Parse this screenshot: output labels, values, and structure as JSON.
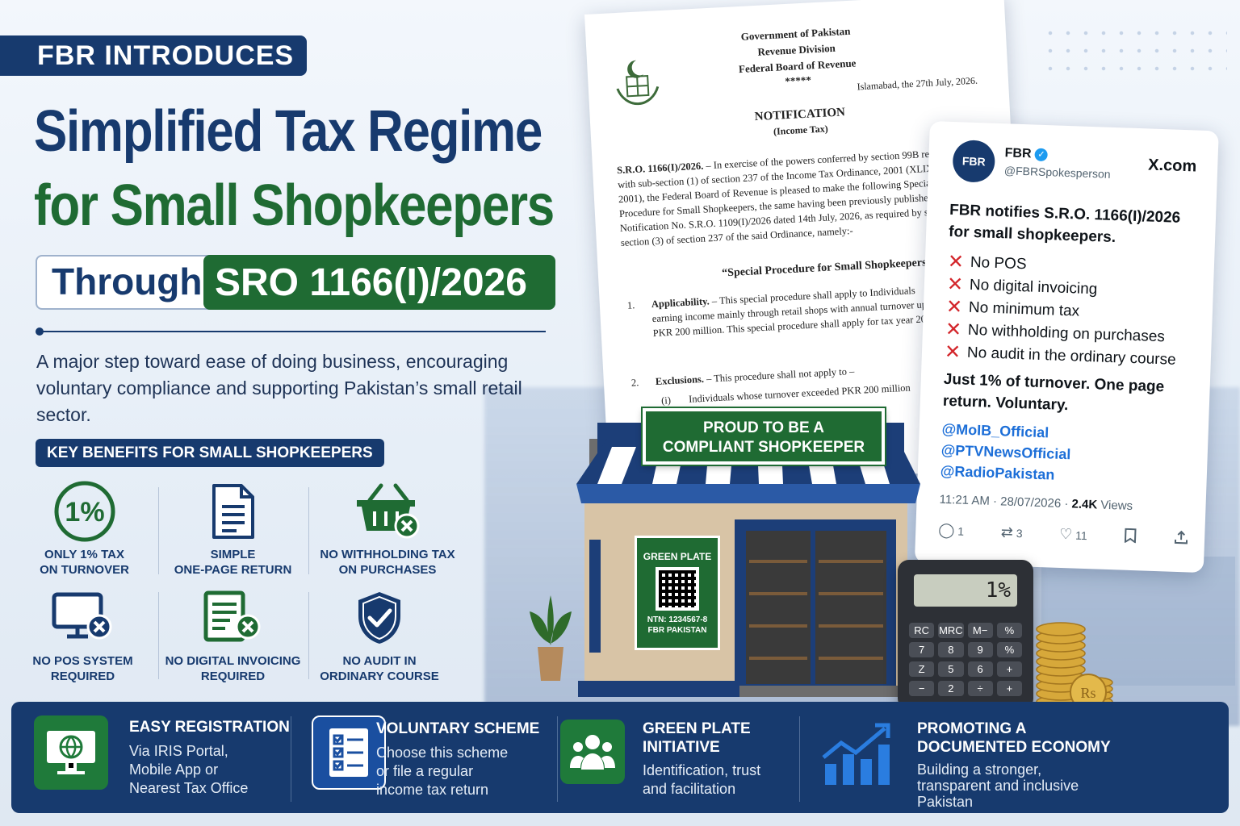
{
  "header": {
    "tag": "FBR INTRODUCES",
    "title_line1": "Simplified Tax Regime",
    "title_line2": "for Small Shopkeepers",
    "through": "Through",
    "sro": "SRO 1166(I)/2026",
    "intro": "A major step toward ease of doing business, encouraging voluntary compliance and supporting Pakistan’s small retail sector."
  },
  "benefits": {
    "heading": "KEY BENEFITS FOR SMALL SHOPKEEPERS",
    "items": [
      {
        "icon": "one-percent-icon",
        "line1": "ONLY 1% TAX",
        "line2": "ON TURNOVER",
        "badge": "1%"
      },
      {
        "icon": "document-icon",
        "line1": "SIMPLE",
        "line2": "ONE-PAGE RETURN"
      },
      {
        "icon": "basket-cross-icon",
        "line1": "NO WITHHOLDING TAX",
        "line2": "ON PURCHASES"
      },
      {
        "icon": "monitor-cross-icon",
        "line1": "NO POS SYSTEM",
        "line2": "REQUIRED"
      },
      {
        "icon": "invoice-cross-icon",
        "line1": "NO DIGITAL INVOICING",
        "line2": "REQUIRED"
      },
      {
        "icon": "shield-check-icon",
        "line1": "NO AUDIT IN",
        "line2": "ORDINARY COURSE"
      }
    ]
  },
  "document": {
    "gov": "Government of Pakistan",
    "division": "Revenue Division",
    "board": "Federal Board of Revenue",
    "stars": "*****",
    "date": "Islamabad, the 27th July, 2026.",
    "notif": "NOTIFICATION",
    "notif_sub": "(Income Tax)",
    "para1_sro": "S.R.O. 1166(I)/2026.",
    "para1": " – In exercise of the powers conferred by section 99B read with sub-section (1) of section 237 of the Income Tax Ordinance, 2001 (XLIX of 2001), the Federal Board of Revenue is pleased to make the following Special Procedure for Small Shopkeepers, the same having been previously published vide Notification No. S.R.O. 1109(I)/2026 dated 14th July, 2026, as required by sub-section (3) of section 237 of the said Ordinance, namely:-",
    "heading": "“Special Procedure for Small Shopkeepers",
    "s1_num": "1.",
    "s1_title": "Applicability.",
    "s1": " – This special procedure shall apply to Individuals earning income mainly through retail shops with annual turnover up to PKR 200 million. This special procedure shall apply for tax year 2026.",
    "s2_num": "2.",
    "s2_title": "Exclusions.",
    "s2": " – This procedure shall not apply to –",
    "s2_i": "(i)",
    "s2_i_text": "Individuals whose turnover exceeded PKR 200 million"
  },
  "tweet": {
    "avatar": "FBR",
    "name": "FBR",
    "handle": "@FBRSpokesperson",
    "site": "X.com",
    "body": "FBR notifies S.R.O. 1166(I)/2026 for small shopkeepers.",
    "x_mark": "✕",
    "points": [
      "No POS",
      "No digital invoicing",
      "No minimum tax",
      "No withholding on purchases",
      "No audit in the ordinary course"
    ],
    "note": "Just 1% of turnover. One page return. Voluntary.",
    "mentions": [
      "@MoIB_Official",
      "@PTVNewsOfficial",
      "@RadioPakistan"
    ],
    "time": "11:21 AM · 28/07/2026 · ",
    "views_count": "2.4K",
    "views_label": " Views",
    "replies": "1",
    "retweets": "3",
    "likes": "11"
  },
  "shop": {
    "sign_line1": "PROUD TO BE A",
    "sign_line2": "COMPLIANT SHOPKEEPER",
    "plate_title": "GREEN PLATE",
    "plate_ntn": "NTN: 1234567-8",
    "plate_org": "FBR PAKISTAN"
  },
  "calculator": {
    "display": "1%",
    "keys": [
      "RC",
      "MRC",
      "M−",
      "%",
      "7",
      "8",
      "9",
      "%",
      "Z",
      "5",
      "6",
      "+",
      "−",
      "2",
      "÷",
      "+"
    ]
  },
  "coin_label": "Rs",
  "bottom": [
    {
      "icon": "globe-monitor-icon",
      "title": [
        "EASY REGISTRATION"
      ],
      "text": [
        "Via IRIS Portal,",
        "Mobile App or",
        "Nearest Tax Office"
      ],
      "color": "#1f7a3a"
    },
    {
      "icon": "checklist-icon",
      "title": [
        "VOLUNTARY SCHEME"
      ],
      "text": [
        "Choose this scheme",
        "or file a regular",
        "income tax return"
      ],
      "color": "#1a4fa0"
    },
    {
      "icon": "people-icon",
      "title": [
        "GREEN PLATE",
        "INITIATIVE"
      ],
      "text": [
        "Identification, trust",
        "and facilitation"
      ],
      "color": "#1f7a3a"
    },
    {
      "icon": "growth-chart-icon",
      "title": [
        "PROMOTING A",
        "DOCUMENTED ECONOMY"
      ],
      "text": [
        "Building a stronger,",
        "transparent and inclusive",
        "Pakistan"
      ],
      "color": "#2a7de0"
    }
  ]
}
